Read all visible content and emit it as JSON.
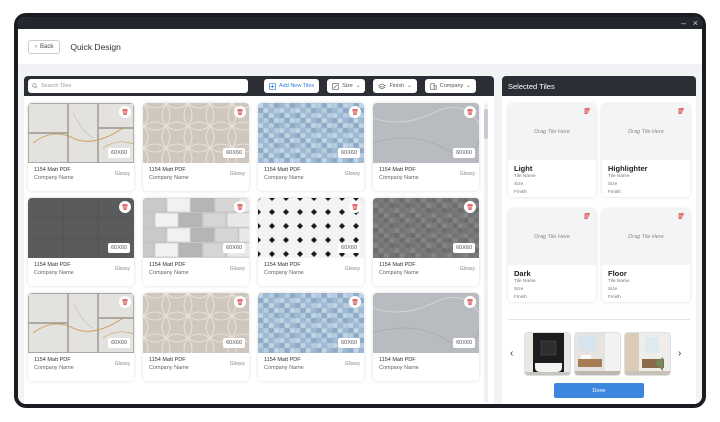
{
  "window": {
    "minimize": "–",
    "close": "×"
  },
  "header": {
    "back_label": "Back",
    "title": "Quick Design"
  },
  "toolbar": {
    "search_placeholder": "Search Tiles",
    "add_label": "Add New Tiles",
    "size_label": "Size",
    "finish_label": "Finish",
    "company_label": "Company"
  },
  "tiles": [
    {
      "name": "1154 Matt PDF",
      "company": "Company Name",
      "finish": "Glossy",
      "size": "60X60",
      "pattern": "marble-panels"
    },
    {
      "name": "1154 Matt PDF",
      "company": "Company Name",
      "finish": "Glossy",
      "size": "60X60",
      "pattern": "circles-beige"
    },
    {
      "name": "1154 Matt PDF",
      "company": "Company Name",
      "finish": "Glossy",
      "size": "60X60",
      "pattern": "blue-mosaic"
    },
    {
      "name": "1154 Matt PDF",
      "company": "Company Name",
      "finish": "Glossy",
      "size": "60X60",
      "pattern": "grey-marble"
    },
    {
      "name": "1154 Matt PDF",
      "company": "Company Name",
      "finish": "Glossy",
      "size": "60X60",
      "pattern": "dark-grey"
    },
    {
      "name": "1154 Matt PDF",
      "company": "Company Name",
      "finish": "Glossy",
      "size": "60X60",
      "pattern": "grey-stone-bricks"
    },
    {
      "name": "1154 Matt PDF",
      "company": "Company Name",
      "finish": "Glossy",
      "size": "60X60",
      "pattern": "octagon-dots"
    },
    {
      "name": "1154 Matt PDF",
      "company": "Company Name",
      "finish": "Glossy",
      "size": "60X60",
      "pattern": "dark-mosaic"
    },
    {
      "name": "1154 Matt PDF",
      "company": "Company Name",
      "finish": "Glossy",
      "size": "60X60",
      "pattern": "marble-panels"
    },
    {
      "name": "1154 Matt PDF",
      "company": "Company Name",
      "finish": "Glossy",
      "size": "60X60",
      "pattern": "circles-beige"
    },
    {
      "name": "1154 Matt PDF",
      "company": "Company Name",
      "finish": "Glossy",
      "size": "60X60",
      "pattern": "blue-mosaic"
    },
    {
      "name": "1154 Matt PDF",
      "company": "Company Name",
      "finish": "",
      "size": "60X60",
      "pattern": "grey-marble"
    }
  ],
  "selected": {
    "title": "Selected Tiles",
    "drop_text": "Drag Tile Here",
    "meta": {
      "name": "Tile Name",
      "size": "Size",
      "finish": "Finish"
    },
    "slots": [
      {
        "label": "Light"
      },
      {
        "label": "Highlighter"
      },
      {
        "label": "Dark"
      },
      {
        "label": "Floor"
      }
    ],
    "prev_icon": "‹",
    "next_icon": "›",
    "done_label": "Done"
  },
  "colors": {
    "accent": "#3d86df",
    "delete": "#d12a2a",
    "toolbar": "#2b2e35"
  }
}
